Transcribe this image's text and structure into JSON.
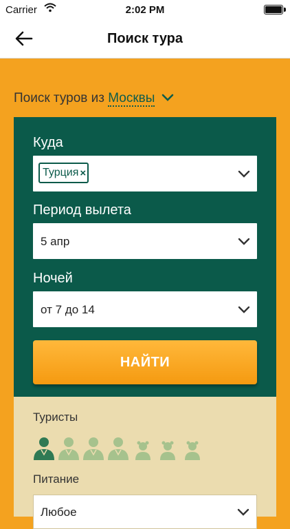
{
  "status_bar": {
    "carrier": "Carrier",
    "time": "2:02 PM"
  },
  "nav": {
    "title": "Поиск тура"
  },
  "origin": {
    "prefix": "Поиск туров из",
    "city": "Москвы"
  },
  "search_form": {
    "destination": {
      "label": "Куда",
      "tag": "Турция"
    },
    "period": {
      "label": "Период вылета",
      "value": "5 апр"
    },
    "nights": {
      "label": "Ночей",
      "value": "от 7 до 14"
    },
    "submit_label": "НАЙТИ"
  },
  "extras": {
    "tourists_label": "Туристы",
    "adults_selected": 1,
    "adults_max": 4,
    "children_max": 3,
    "meal_label": "Питание",
    "meal_value": "Любое"
  },
  "colors": {
    "accent_orange": "#f4a21f",
    "form_green": "#0b5a4a",
    "panel_beige": "#ebdcaf"
  }
}
